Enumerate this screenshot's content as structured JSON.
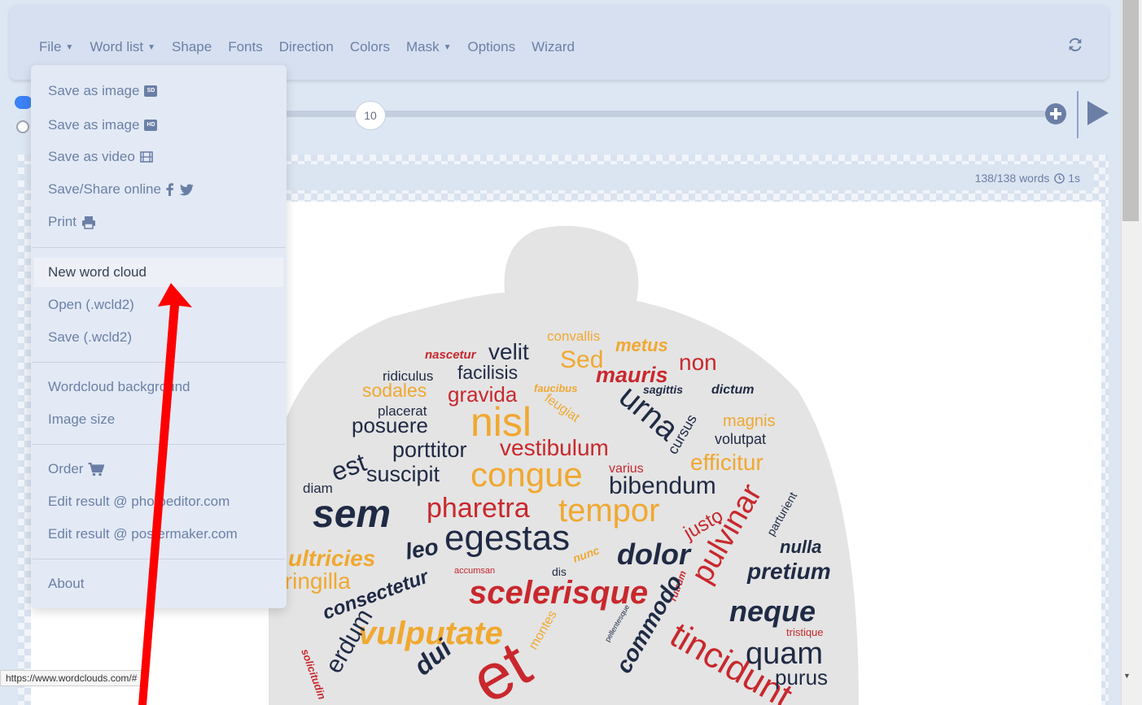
{
  "navbar": {
    "items": [
      {
        "label": "File",
        "caret": true
      },
      {
        "label": "Word list",
        "caret": true
      },
      {
        "label": "Shape",
        "caret": false
      },
      {
        "label": "Fonts",
        "caret": false
      },
      {
        "label": "Direction",
        "caret": false
      },
      {
        "label": "Colors",
        "caret": false
      },
      {
        "label": "Mask",
        "caret": true
      },
      {
        "label": "Options",
        "caret": false
      },
      {
        "label": "Wizard",
        "caret": false
      }
    ],
    "refresh_icon": "refresh-icon"
  },
  "slider": {
    "value": "10"
  },
  "word_count": "138/138 words",
  "time": "1s",
  "file_menu": {
    "save_sd": "Save as image",
    "sd_badge": "SD",
    "save_hd": "Save as image",
    "hd_badge": "HD",
    "save_video": "Save as video",
    "save_share": "Save/Share online",
    "print": "Print",
    "new_cloud": "New word cloud",
    "open": "Open (.wcld2)",
    "save": "Save (.wcld2)",
    "background": "Wordcloud background",
    "image_size": "Image size",
    "order": "Order",
    "edit_photo": "Edit result @ photoeditor.com",
    "edit_poster": "Edit result @ postermaker.com",
    "about": "About"
  },
  "status_url": "https://www.wordclouds.com/#",
  "colors": {
    "accent": "#3b82f6",
    "red": "#c8282d",
    "orange": "#f0a830",
    "navy": "#1f2a44",
    "arrow": "#ff0000"
  },
  "wordcloud_words": [
    "convallis",
    "nascetur",
    "velit",
    "Sed",
    "metus",
    "non",
    "ridiculus",
    "facilisis",
    "mauris",
    "sodales",
    "gravida",
    "faucibus",
    "sagittis",
    "dictum",
    "placerat",
    "nisl",
    "feugiat",
    "urna",
    "magnis",
    "posuere",
    "cursus",
    "volutpat",
    "est",
    "porttitor",
    "vestibulum",
    "varius",
    "efficitur",
    "suscipit",
    "congue",
    "bibendum",
    "diam",
    "sem",
    "pharetra",
    "tempor",
    "justo",
    "parturient",
    "leo",
    "egestas",
    "dolor",
    "pulvinar",
    "nulla",
    "ultricies",
    "dis",
    "nunc",
    "accumsan",
    "pretium",
    "fringilla",
    "consectetur",
    "scelerisque",
    "rutrum",
    "neque",
    "vulputate",
    "commodo",
    "tincidunt",
    "tristique",
    "montes",
    "dui",
    "erdum",
    "solicitudin",
    "quam",
    "purus",
    "et",
    "pellentesque"
  ]
}
